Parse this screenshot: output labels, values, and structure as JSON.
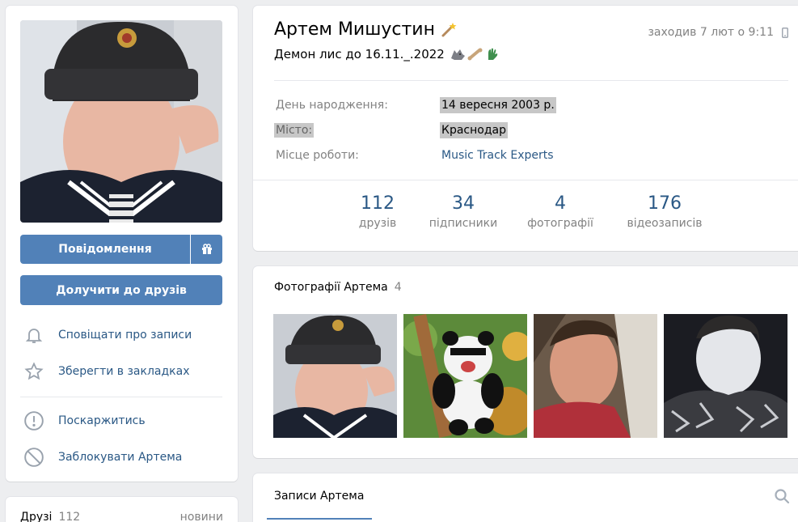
{
  "left": {
    "message_button": "Повідомлення",
    "add_friend_button": "Долучити до друзів",
    "actions": [
      {
        "label": "Сповіщати про записи",
        "icon": "bell-icon"
      },
      {
        "label": "Зберегти в закладках",
        "icon": "star-icon"
      },
      {
        "label": "Поскаржитись",
        "icon": "exclamation-icon"
      },
      {
        "label": "Заблокувати Артема",
        "icon": "block-icon"
      }
    ]
  },
  "friends": {
    "title": "Друзі",
    "count": "112",
    "news_link": "новини"
  },
  "profile": {
    "name": "Артем Мишустин",
    "status": "Демон лис до 16.11._.2022",
    "last_seen": "заходив 7 лют о 9:11",
    "info": [
      {
        "label": "День народження:",
        "value": "14 вересня 2003 р."
      },
      {
        "label": "Місто:",
        "value": "Краснодар"
      },
      {
        "label": "Місце роботи:",
        "value": "Music Track Experts"
      }
    ],
    "counters": [
      {
        "num": "112",
        "caption": "друзів"
      },
      {
        "num": "34",
        "caption": "підписники"
      },
      {
        "num": "4",
        "caption": "фотографії"
      },
      {
        "num": "176",
        "caption": "відеозаписів"
      }
    ]
  },
  "photos": {
    "title": "Фотографії Артема",
    "count": "4"
  },
  "posts": {
    "tab": "Записи Артема"
  },
  "colors": {
    "accent": "#5181b8",
    "link": "#2a5885",
    "muted": "#828282",
    "background": "#edeef0"
  }
}
